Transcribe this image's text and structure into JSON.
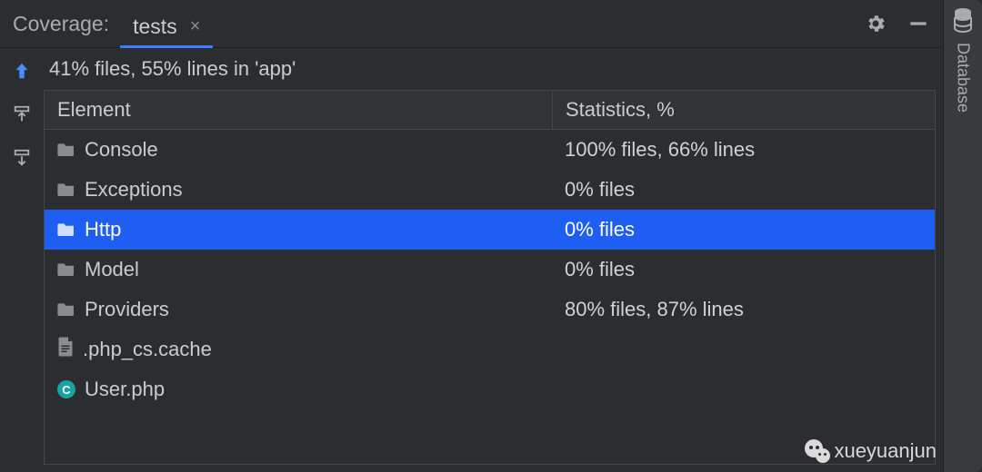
{
  "header": {
    "title": "Coverage:",
    "tab_label": "tests"
  },
  "summary": "41% files, 55% lines in 'app'",
  "columns": {
    "element": "Element",
    "stats": "Statistics, %"
  },
  "rows": [
    {
      "kind": "folder",
      "name": "Console",
      "stats": "100% files, 66% lines",
      "selected": false
    },
    {
      "kind": "folder",
      "name": "Exceptions",
      "stats": "0% files",
      "selected": false
    },
    {
      "kind": "folder",
      "name": "Http",
      "stats": "0% files",
      "selected": true
    },
    {
      "kind": "folder",
      "name": "Model",
      "stats": "0% files",
      "selected": false
    },
    {
      "kind": "folder",
      "name": "Providers",
      "stats": "80% files, 87% lines",
      "selected": false
    },
    {
      "kind": "file",
      "name": ".php_cs.cache",
      "stats": "",
      "selected": false
    },
    {
      "kind": "class",
      "name": "User.php",
      "stats": "",
      "selected": false
    }
  ],
  "side_tab": {
    "label": "Database"
  },
  "watermark": "xueyuanjun",
  "icons": {
    "gear": "gear-icon",
    "minimize": "minimize-icon",
    "up": "flatten-up-icon",
    "export": "export-icon",
    "import": "import-icon",
    "folder": "folder-icon",
    "file": "file-icon",
    "class_badge": "C",
    "database": "database-icon",
    "close": "×"
  }
}
